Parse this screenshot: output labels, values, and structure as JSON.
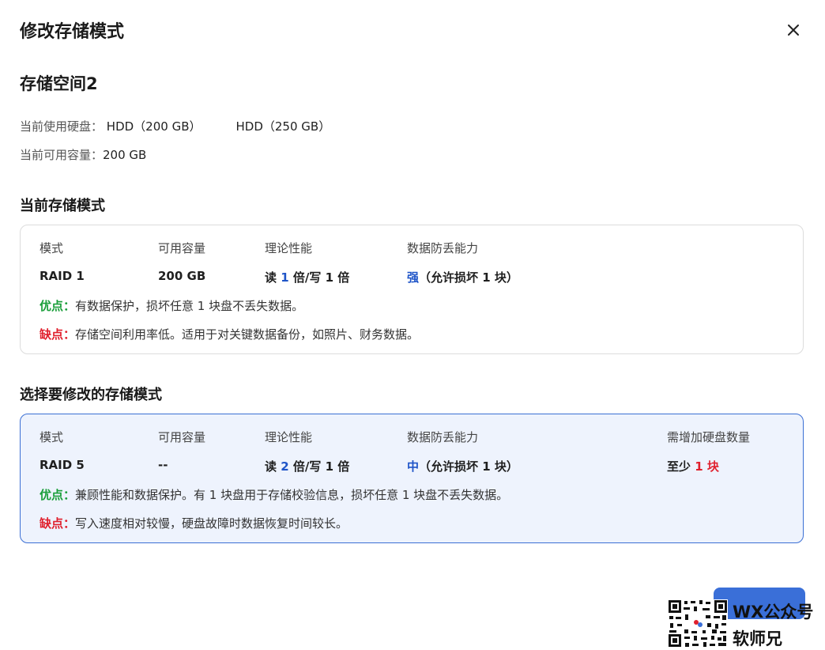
{
  "dialog": {
    "title": "修改存储模式",
    "close_icon": "close-icon"
  },
  "space": {
    "name": "存储空间2",
    "disks_label": "当前使用硬盘：",
    "disks": [
      "HDD（200 GB）",
      "HDD（250 GB）"
    ],
    "capacity_label": "当前可用容量：",
    "capacity_value": "200 GB"
  },
  "current": {
    "section_title": "当前存储模式",
    "headers": {
      "mode": "模式",
      "capacity": "可用容量",
      "perf": "理论性能",
      "protection": "数据防丢能力"
    },
    "mode": "RAID 1",
    "capacity": "200 GB",
    "perf": {
      "read_prefix": "读 ",
      "read_num": "1",
      "rest": " 倍/写 1 倍"
    },
    "protection": {
      "level": "强",
      "detail": "（允许损坏 1 块）"
    },
    "pros_label": "优点：",
    "pros": "有数据保护，损坏任意 1 块盘不丢失数据。",
    "cons_label": "缺点：",
    "cons": "存储空间利用率低。适用于对关键数据备份，如照片、财务数据。"
  },
  "target": {
    "section_title": "选择要修改的存储模式",
    "headers": {
      "mode": "模式",
      "capacity": "可用容量",
      "perf": "理论性能",
      "protection": "数据防丢能力",
      "disks_needed": "需增加硬盘数量"
    },
    "mode": "RAID 5",
    "capacity": "--",
    "perf": {
      "read_prefix": "读 ",
      "read_num": "2",
      "rest": " 倍/写 1 倍"
    },
    "protection": {
      "level": "中",
      "detail": "（允许损坏 1 块）"
    },
    "disks_needed": {
      "prefix": "至少 ",
      "count": "1 块"
    },
    "pros_label": "优点：",
    "pros": "兼顾性能和数据保护。有 1 块盘用于存储校验信息，损坏任意 1 块盘不丢失数据。",
    "cons_label": "缺点：",
    "cons": "写入速度相对较慢，硬盘故障时数据恢复时间较长。"
  },
  "footer": {
    "confirm_label": ""
  },
  "watermark": {
    "line1": "WX公众号",
    "line2": "软师兄"
  },
  "colors": {
    "accent": "#3a6fd8",
    "blue": "#1f55c8",
    "red": "#e0202d",
    "green": "#1a9e3a"
  }
}
